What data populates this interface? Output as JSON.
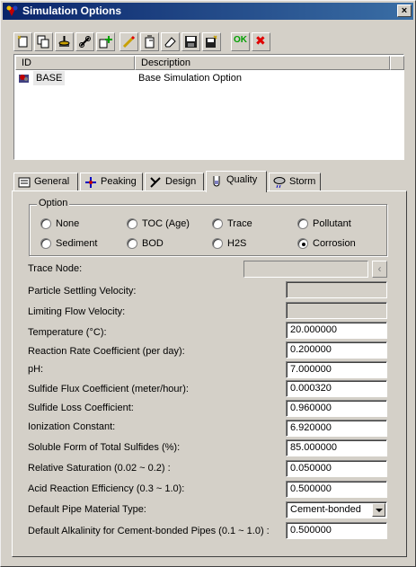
{
  "window": {
    "title": "Simulation Options",
    "close_label": "×"
  },
  "toolbar": {
    "buttons": [
      {
        "name": "new-icon"
      },
      {
        "name": "copy-icon"
      },
      {
        "name": "import-icon"
      },
      {
        "name": "link-icon"
      },
      {
        "name": "add-icon"
      },
      {
        "name": "edit-icon"
      },
      {
        "name": "paste-icon"
      },
      {
        "name": "erase-icon"
      },
      {
        "name": "save-icon"
      },
      {
        "name": "save-all-icon"
      }
    ],
    "ok_label": "OK",
    "cancel_label": "✖"
  },
  "list": {
    "columns": [
      "ID",
      "Description"
    ],
    "rows": [
      {
        "id": "BASE",
        "description": "Base Simulation Option"
      }
    ]
  },
  "tabs": [
    {
      "label": "General",
      "icon": "general-icon"
    },
    {
      "label": "Peaking",
      "icon": "peaking-icon"
    },
    {
      "label": "Design",
      "icon": "design-icon"
    },
    {
      "label": "Quality",
      "icon": "quality-icon",
      "active": true
    },
    {
      "label": "Storm",
      "icon": "storm-icon"
    }
  ],
  "option_group": {
    "label": "Option",
    "options": [
      "None",
      "TOC (Age)",
      "Trace",
      "Pollutant",
      "Sediment",
      "BOD",
      "H2S",
      "Corrosion"
    ],
    "selected": "Corrosion"
  },
  "fields": {
    "trace_node": {
      "label": "Trace Node:",
      "value": ""
    },
    "particle_settling_velocity": {
      "label": "Particle Settling Velocity:",
      "value": ""
    },
    "limiting_flow_velocity": {
      "label": "Limiting Flow Velocity:",
      "value": ""
    },
    "temperature": {
      "label": "Temperature (°C):",
      "value": "20.000000"
    },
    "reaction_rate": {
      "label": "Reaction Rate Coefficient (per day):",
      "value": "0.200000"
    },
    "ph": {
      "label": "pH:",
      "value": "7.000000"
    },
    "sulfide_flux": {
      "label": "Sulfide Flux Coefficient (meter/hour):",
      "value": "0.000320"
    },
    "sulfide_loss": {
      "label": "Sulfide Loss Coefficient:",
      "value": "0.960000"
    },
    "ionization": {
      "label": "Ionization Constant:",
      "value": "6.920000"
    },
    "soluble_form": {
      "label": "Soluble Form of Total Sulfides (%):",
      "value": "85.000000"
    },
    "relative_saturation": {
      "label": "Relative Saturation (0.02 ~ 0.2) :",
      "value": "0.050000"
    },
    "acid_reaction": {
      "label": "Acid Reaction Efficiency (0.3 ~ 1.0):",
      "value": "0.500000"
    },
    "pipe_material": {
      "label": "Default Pipe Material Type:",
      "value": "Cement-bonded"
    },
    "alkalinity": {
      "label": "Default Alkalinity for Cement-bonded Pipes (0.1 ~ 1.0) :",
      "value": "0.500000"
    }
  },
  "colors": {
    "title_start": "#0a246a",
    "title_end": "#3a6ea5",
    "ok": "#00a000",
    "cancel": "#e00000"
  }
}
